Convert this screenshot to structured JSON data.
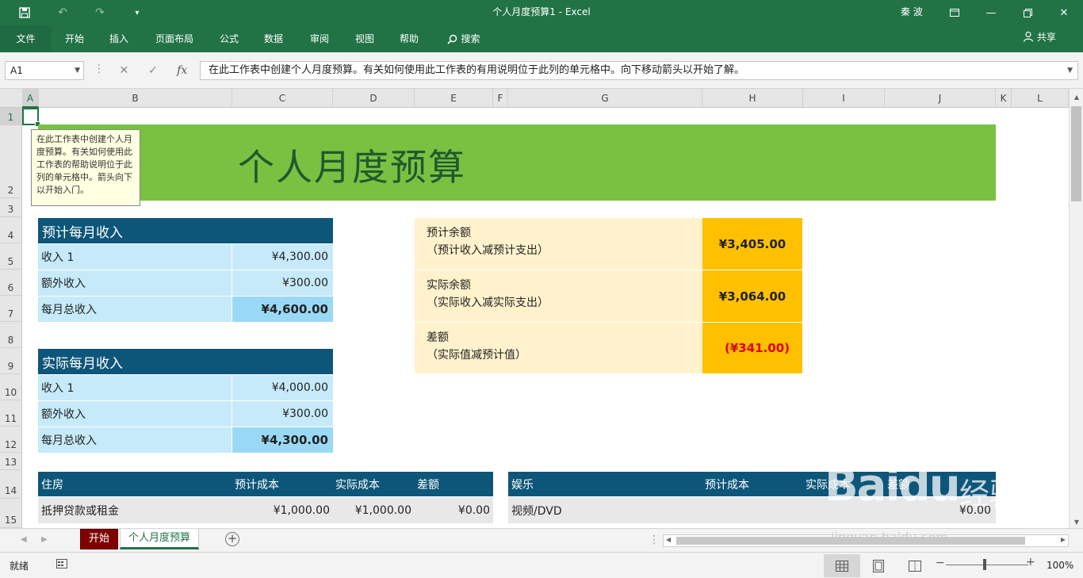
{
  "titlebar": {
    "save_icon": "save-icon",
    "title": "个人月度预算1  -  Excel",
    "user": "秦 波",
    "icons": [
      "undo-icon",
      "redo-icon",
      "customize-qat-icon",
      "ribbon-display-icon",
      "minimize-icon",
      "restore-icon",
      "close-icon"
    ]
  },
  "ribbon": {
    "tabs": [
      "文件",
      "开始",
      "插入",
      "页面布局",
      "公式",
      "数据",
      "审阅",
      "视图",
      "帮助"
    ],
    "search": "搜索",
    "share": "共享"
  },
  "formula_bar": {
    "name_box": "A1",
    "formula": "在此工作表中创建个人月度预算。有关如何使用此工作表的有用说明位于此列的单元格中。向下移动箭头以开始了解。"
  },
  "columns": [
    "A",
    "B",
    "C",
    "D",
    "E",
    "F",
    "G",
    "H",
    "I",
    "J",
    "K",
    "L"
  ],
  "rows": [
    "1",
    "2",
    "3",
    "4",
    "5",
    "6",
    "7",
    "8",
    "9",
    "10",
    "11",
    "12",
    "13",
    "14",
    "15"
  ],
  "tooltip": "在此工作表中创建个人月度预算。有关如何使用此工作表的帮助说明位于此列的单元格中。箭头向下以开始入门。",
  "banner_title": "个人月度预算",
  "projected_income": {
    "header": "预计每月收入",
    "rows": [
      {
        "label": "收入 1",
        "value": "¥4,300.00"
      },
      {
        "label": "额外收入",
        "value": "¥300.00"
      },
      {
        "label": "每月总收入",
        "value": "¥4,600.00"
      }
    ]
  },
  "actual_income": {
    "header": "实际每月收入",
    "rows": [
      {
        "label": "收入 1",
        "value": "¥4,000.00"
      },
      {
        "label": "额外收入",
        "value": "¥300.00"
      },
      {
        "label": "每月总收入",
        "value": "¥4,300.00"
      }
    ]
  },
  "summary": [
    {
      "label": "预计余额",
      "sub": "（预计收入减预计支出）",
      "value": "¥3,405.00"
    },
    {
      "label": "实际余额",
      "sub": "（实际收入减实际支出）",
      "value": "¥3,064.00"
    },
    {
      "label": "差额",
      "sub": "（实际值减预计值）",
      "value": "(¥341.00)"
    }
  ],
  "housing": {
    "headers": [
      "住房",
      "预计成本",
      "实际成本",
      "差额"
    ],
    "row": [
      "抵押贷款或租金",
      "¥1,000.00",
      "¥1,000.00",
      "¥0.00"
    ]
  },
  "entertainment": {
    "headers": [
      "娱乐",
      "预计成本",
      "实际成本",
      "差额"
    ],
    "row": [
      "视频/DVD",
      "",
      "",
      "¥0.00"
    ]
  },
  "sheets": [
    "开始",
    "个人月度预算"
  ],
  "status": {
    "ready": "就绪",
    "zoom": "100%"
  },
  "watermark": {
    "brand": "Baidu",
    "cn": "经验",
    "url": "jingyan.baidu.com"
  },
  "colors": {
    "excel_green": "#217346",
    "banner": "#7ac142",
    "header_blue": "#0d5679",
    "income_cell": "#c6eafa",
    "summary_bg": "#fff2cc",
    "summary_value": "#ffc000",
    "negative": "#e00000"
  }
}
